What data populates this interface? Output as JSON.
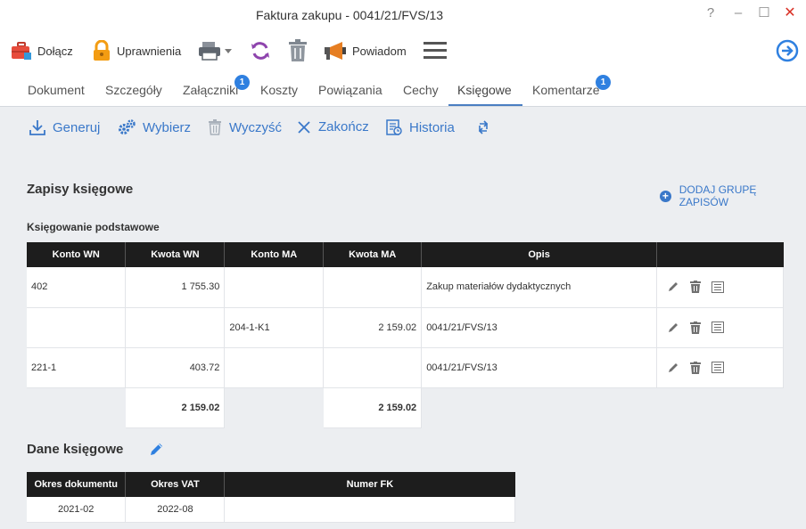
{
  "window": {
    "title": "Faktura zakupu - 0041/21/FVS/13",
    "help": "?",
    "minimize": "–",
    "maximize": "☐",
    "close": "✕"
  },
  "toolbar": {
    "attach_label": "Dołącz",
    "permissions_label": "Uprawnienia",
    "notify_label": "Powiadom"
  },
  "tabs": [
    {
      "label": "Dokument"
    },
    {
      "label": "Szczegóły"
    },
    {
      "label": "Załączniki",
      "badge": "1"
    },
    {
      "label": "Koszty"
    },
    {
      "label": "Powiązania"
    },
    {
      "label": "Cechy"
    },
    {
      "label": "Księgowe",
      "active": true
    },
    {
      "label": "Komentarze",
      "badge": "1"
    }
  ],
  "actions": {
    "generate": "Generuj",
    "select": "Wybierz",
    "clear": "Wyczyść",
    "finish": "Zakończ",
    "history": "Historia"
  },
  "entries": {
    "title": "Zapisy księgowe",
    "add_group": "DODAJ GRUPĘ ZAPISÓW",
    "subtitle": "Księgowanie podstawowe",
    "columns": [
      "Konto WN",
      "Kwota WN",
      "Konto MA",
      "Kwota MA",
      "Opis",
      ""
    ],
    "rows": [
      {
        "konto_wn": "402",
        "kwota_wn": "1 755.30",
        "konto_ma": "",
        "kwota_ma": "",
        "opis": "Zakup materiałów dydaktycznych"
      },
      {
        "konto_wn": "",
        "kwota_wn": "",
        "konto_ma": "204-1-K1",
        "kwota_ma": "2 159.02",
        "opis": "0041/21/FVS/13"
      },
      {
        "konto_wn": "221-1",
        "kwota_wn": "403.72",
        "konto_ma": "",
        "kwota_ma": "",
        "opis": "0041/21/FVS/13"
      }
    ],
    "total_wn": "2 159.02",
    "total_ma": "2 159.02"
  },
  "accounting_data": {
    "title": "Dane księgowe",
    "columns": [
      "Okres dokumentu",
      "Okres VAT",
      "Numer FK"
    ],
    "values": {
      "okres_dokumentu": "2021-02",
      "okres_vat": "2022-08",
      "numer_fk": ""
    }
  },
  "colors": {
    "accent": "#3a78c9",
    "header_bg": "#1d1d1d",
    "badge": "#2f80e0",
    "close": "#d93025"
  },
  "icons": [
    "briefcase-icon",
    "lock-icon",
    "printer-icon",
    "sync-icon",
    "trash-icon",
    "megaphone-icon",
    "menu-icon",
    "arrow-right-circle-icon",
    "download-icon",
    "gears-icon",
    "close-x-icon",
    "history-icon",
    "refresh-icon",
    "pencil-icon"
  ]
}
